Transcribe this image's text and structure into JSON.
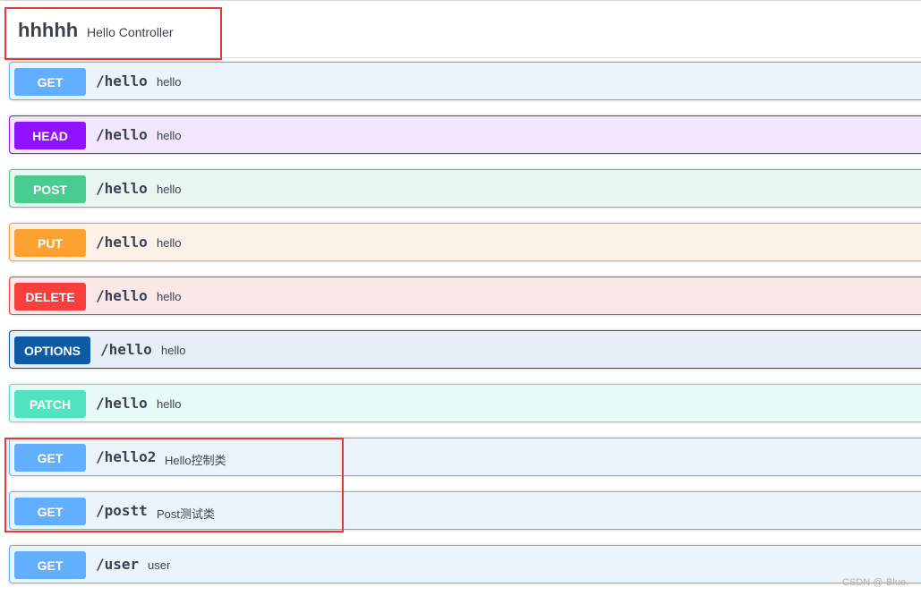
{
  "tag": {
    "name": "hhhhh",
    "description": "Hello Controller"
  },
  "operations": [
    {
      "method": "GET",
      "path": "/hello",
      "summary": "hello",
      "color": "#61affe",
      "bg": "#ebf3fb",
      "border": "#61affe"
    },
    {
      "method": "HEAD",
      "path": "/hello",
      "summary": "hello",
      "color": "#9012fe",
      "bg": "#f3e7fe",
      "border": "#9012fe"
    },
    {
      "method": "POST",
      "path": "/hello",
      "summary": "hello",
      "color": "#49cc90",
      "bg": "#e8f6f0",
      "border": "#49cc90"
    },
    {
      "method": "PUT",
      "path": "/hello",
      "summary": "hello",
      "color": "#fca130",
      "bg": "#fbf1e6",
      "border": "#fca130"
    },
    {
      "method": "DELETE",
      "path": "/hello",
      "summary": "hello",
      "color": "#f93e3e",
      "bg": "#fae7e7",
      "border": "#f93e3e"
    },
    {
      "method": "OPTIONS",
      "path": "/hello",
      "summary": "hello",
      "color": "#0d5aa7",
      "bg": "#e7eef6",
      "border": "#0d5aa7"
    },
    {
      "method": "PATCH",
      "path": "/hello",
      "summary": "hello",
      "color": "#50e3c2",
      "bg": "#e9fbf7",
      "border": "#50e3c2"
    },
    {
      "method": "GET",
      "path": "/hello2",
      "summary": "Hello控制类",
      "color": "#61affe",
      "bg": "#ebf3fb",
      "border": "#61affe"
    },
    {
      "method": "GET",
      "path": "/postt",
      "summary": "Post测试类",
      "color": "#61affe",
      "bg": "#ebf3fb",
      "border": "#61affe"
    },
    {
      "method": "GET",
      "path": "/user",
      "summary": "user",
      "color": "#61affe",
      "bg": "#ebf3fb",
      "border": "#61affe"
    }
  ],
  "watermark": "CSDN @-Blue."
}
